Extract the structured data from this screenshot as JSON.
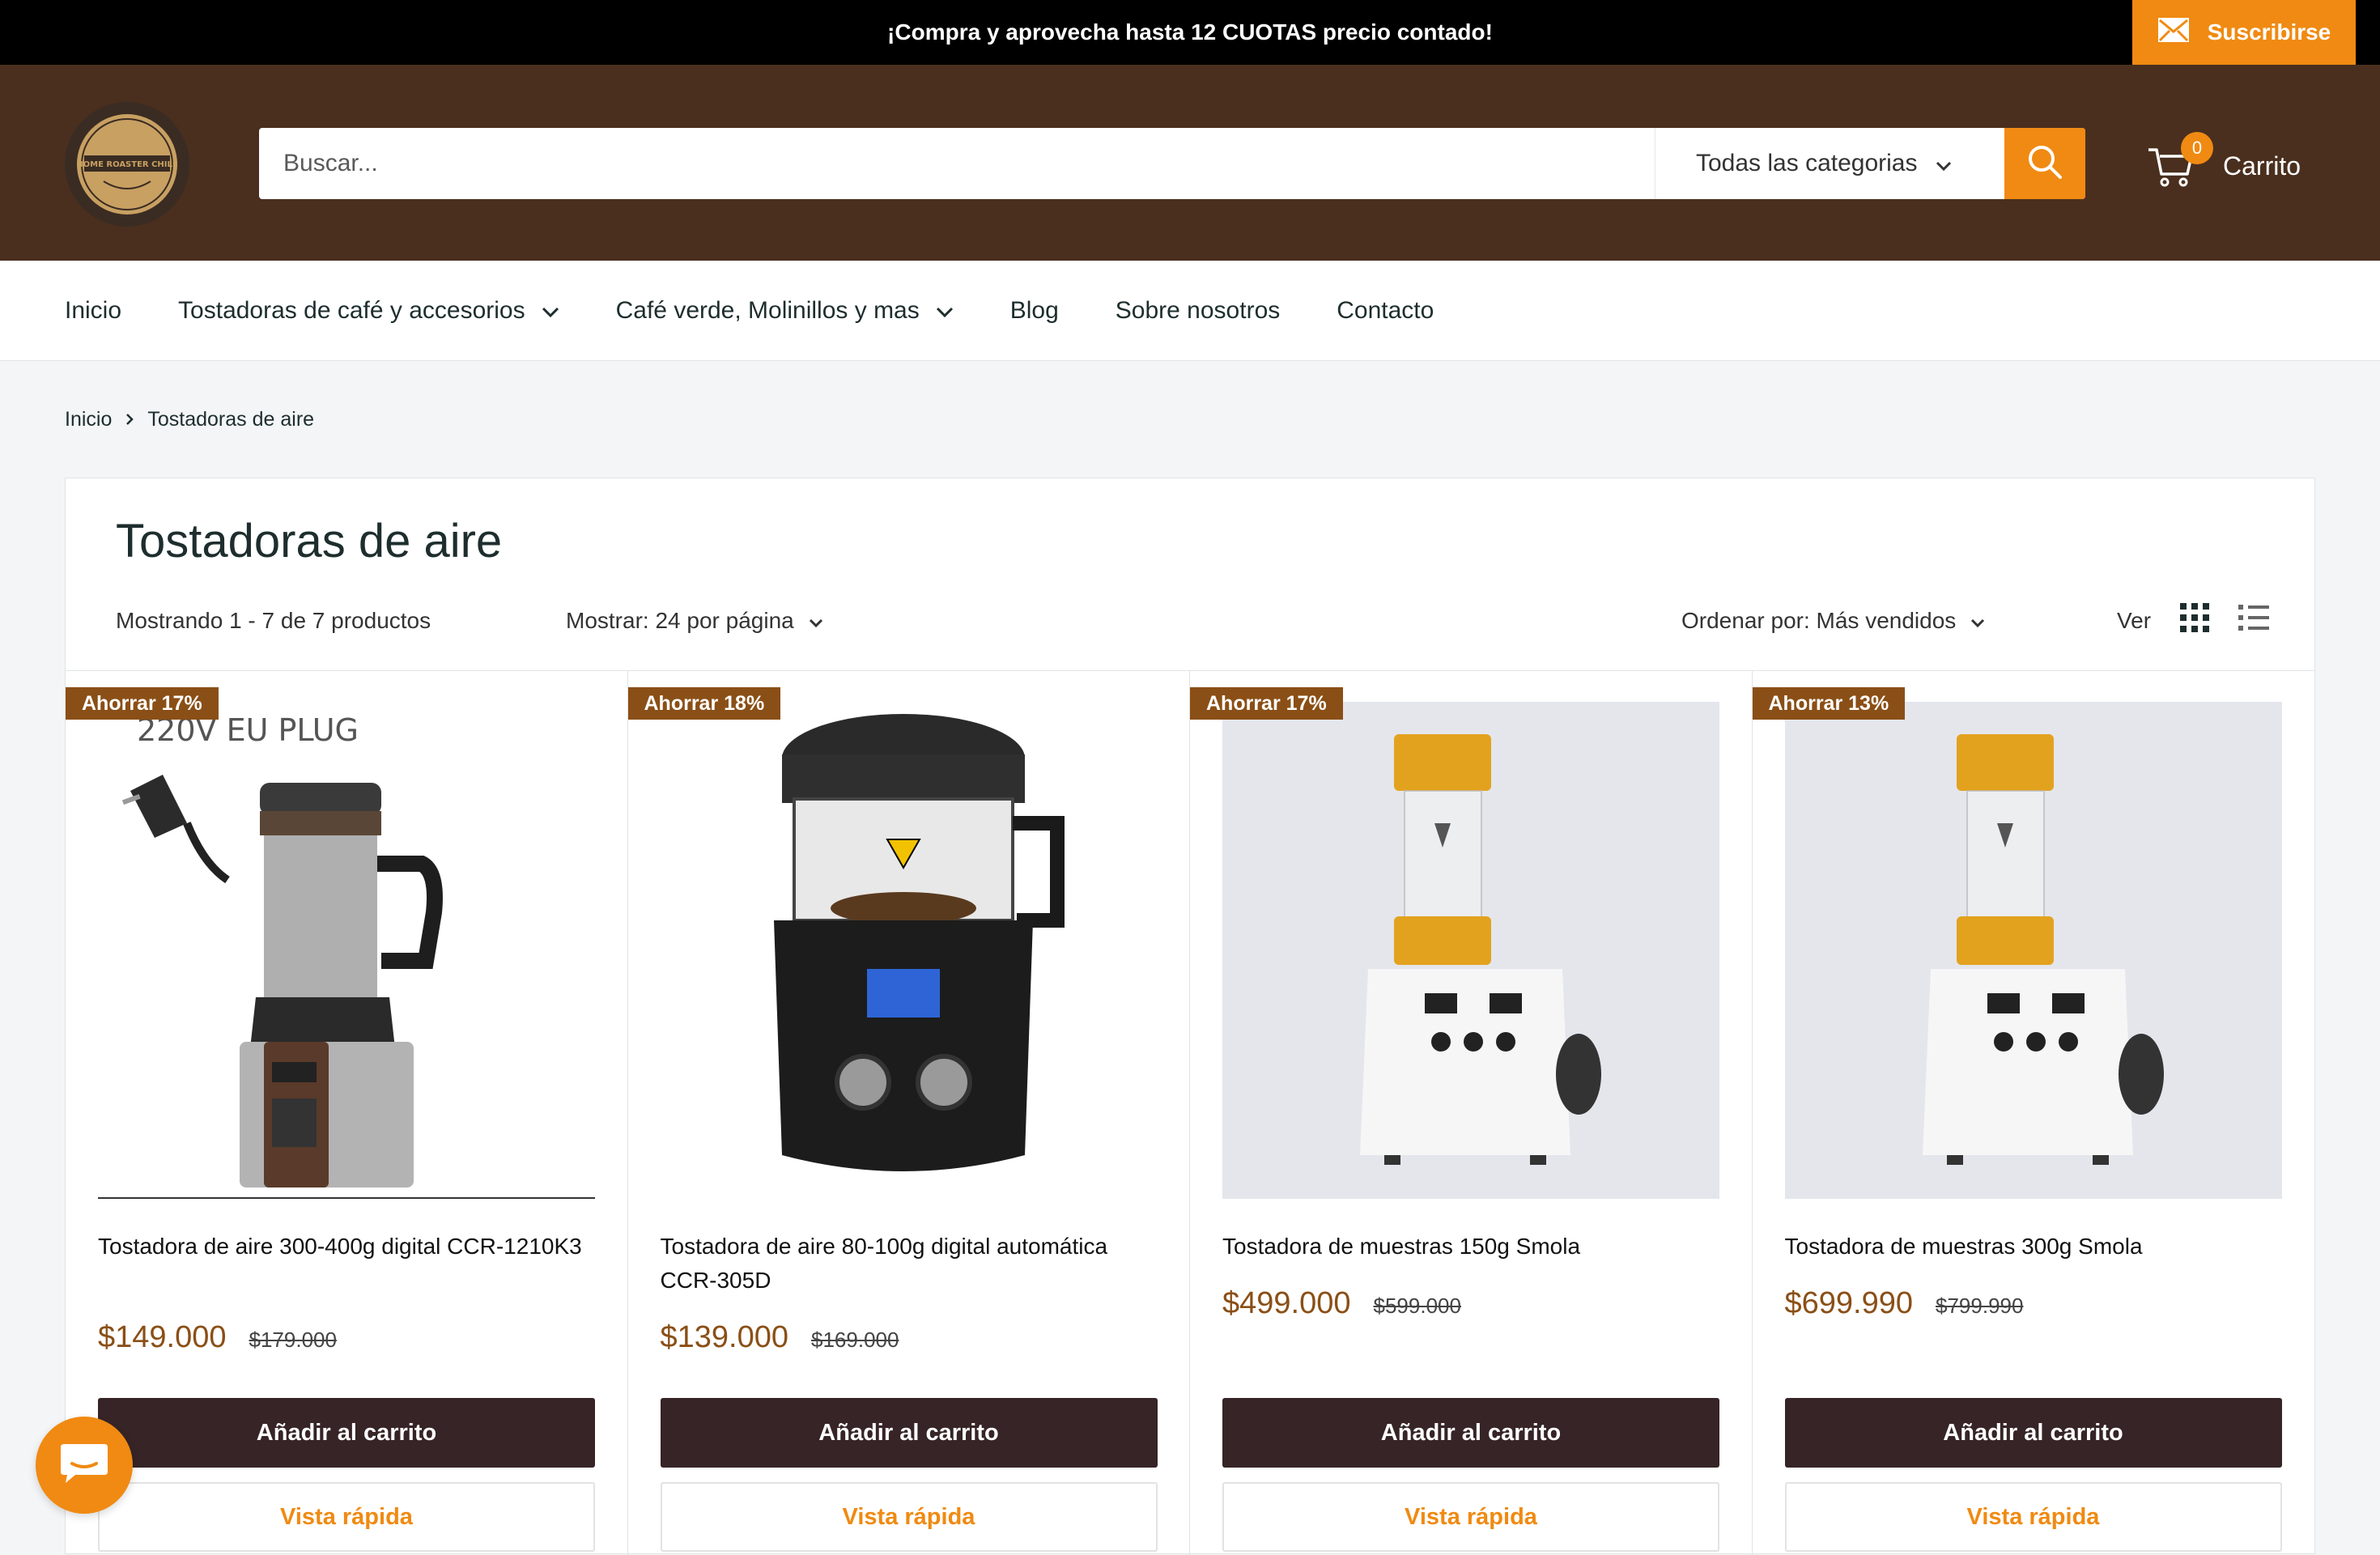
{
  "announcement": {
    "text": "¡Compra y aprovecha hasta 12 CUOTAS precio contado!",
    "subscribe_label": "Suscribirse"
  },
  "header": {
    "logo_text": "HOME ROASTER CHILE",
    "search_placeholder": "Buscar...",
    "category_label": "Todas las categorias",
    "cart_count": "0",
    "cart_label": "Carrito"
  },
  "nav": {
    "items": [
      {
        "label": "Inicio"
      },
      {
        "label": "Tostadoras de café y accesorios"
      },
      {
        "label": "Café verde, Molinillos y mas"
      },
      {
        "label": "Blog"
      },
      {
        "label": "Sobre nosotros"
      },
      {
        "label": "Contacto"
      }
    ]
  },
  "breadcrumb": {
    "home": "Inicio",
    "current": "Tostadoras de aire"
  },
  "collection": {
    "title": "Tostadoras de aire",
    "showing": "Mostrando 1 - 7 de 7 productos",
    "per_page": "Mostrar: 24 por página",
    "sort": "Ordenar por: Más vendidos",
    "view_label": "Ver"
  },
  "products": [
    {
      "badge": "Ahorrar 17%",
      "title": "Tostadora de aire 300-400g digital CCR-1210K3",
      "price": "$149.000",
      "compare_price": "$179.000",
      "image_caption": "220V EU PLUG",
      "add_label": "Añadir al carrito",
      "quick_label": "Vista rápida"
    },
    {
      "badge": "Ahorrar 18%",
      "title": "Tostadora de aire 80-100g digital automática CCR-305D",
      "price": "$139.000",
      "compare_price": "$169.000",
      "add_label": "Añadir al carrito",
      "quick_label": "Vista rápida"
    },
    {
      "badge": "Ahorrar 17%",
      "title": "Tostadora de muestras 150g Smola",
      "price": "$499.000",
      "compare_price": "$599.000",
      "add_label": "Añadir al carrito",
      "quick_label": "Vista rápida"
    },
    {
      "badge": "Ahorrar 13%",
      "title": "Tostadora de muestras 300g Smola",
      "price": "$699.990",
      "compare_price": "$799.990",
      "add_label": "Añadir al carrito",
      "quick_label": "Vista rápida"
    }
  ],
  "colors": {
    "accent": "#f08a12",
    "header_bg": "#4a2f1e",
    "button_dark": "#362426",
    "price": "#8a4f16"
  }
}
